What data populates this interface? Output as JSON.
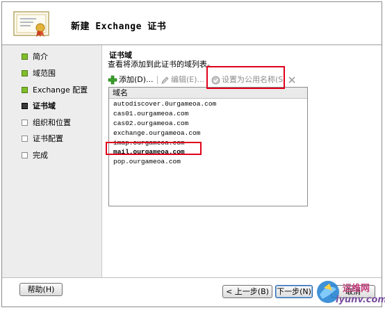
{
  "window": {
    "title": "新建 Exchange 证书"
  },
  "steps": [
    {
      "label": "简介",
      "status": "done"
    },
    {
      "label": "域范围",
      "status": "done"
    },
    {
      "label": "Exchange 配置",
      "status": "done"
    },
    {
      "label": "证书域",
      "status": "current"
    },
    {
      "label": "组织和位置",
      "status": "todo"
    },
    {
      "label": "证书配置",
      "status": "todo"
    },
    {
      "label": "完成",
      "status": "todo"
    }
  ],
  "section": {
    "title": "证书域",
    "description": "查看将添加到此证书的域列表。"
  },
  "toolbar": {
    "add_label": "添加(D)...",
    "edit_label": "编辑(E)...",
    "set_common_name_label": "设置为公用名称(S",
    "delete_icon": "delete-x-icon"
  },
  "list": {
    "column_header": "域名",
    "rows": [
      "autodiscover.0urgameoa.com",
      "cas01.ourgameoa.com",
      "cas02.ourgameoa.com",
      "exchange.ourgameoa.com",
      "imap.ourgameoa.com",
      "mail.ourgameoa.com",
      "pop.ourgameoa.com"
    ],
    "selected_index": 5
  },
  "footer": {
    "help_label": "帮助(H)",
    "back_label": "< 上一步(B)",
    "next_label": "下一步(N)",
    "cancel_label": "取消"
  },
  "watermark": {
    "line1": "运维网",
    "line2": "iyunv.com"
  },
  "colors": {
    "highlight_red": "#e0001b",
    "step_done": "#7fbf2a",
    "sidebar_bg": "#ededed"
  }
}
